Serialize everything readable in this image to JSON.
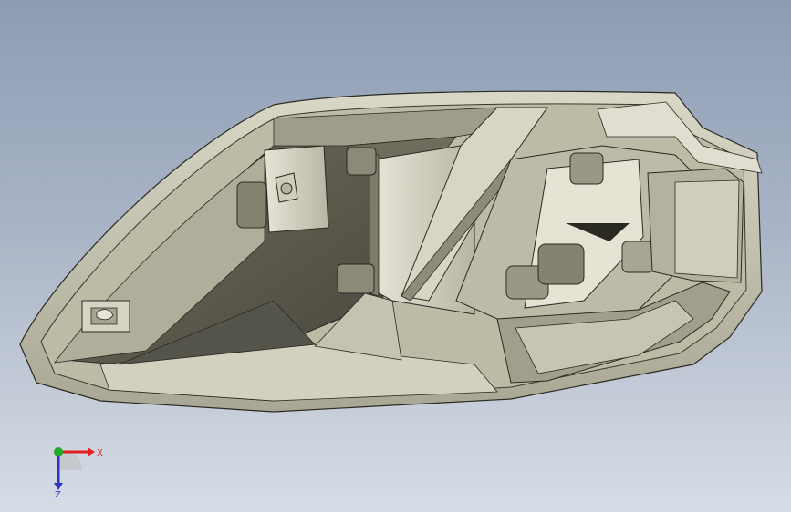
{
  "viewport": {
    "background_top": "#8e9cb3",
    "background_bottom": "#d7dde6"
  },
  "model": {
    "shell_color": "#c9c6b3",
    "shadow_color": "#8f8c78",
    "edge_color": "#2a2a22"
  },
  "triad": {
    "x_label": "X",
    "z_label": "Z",
    "x_color": "#e02020",
    "y_color": "#1faa2a",
    "z_color": "#2b35c8"
  }
}
